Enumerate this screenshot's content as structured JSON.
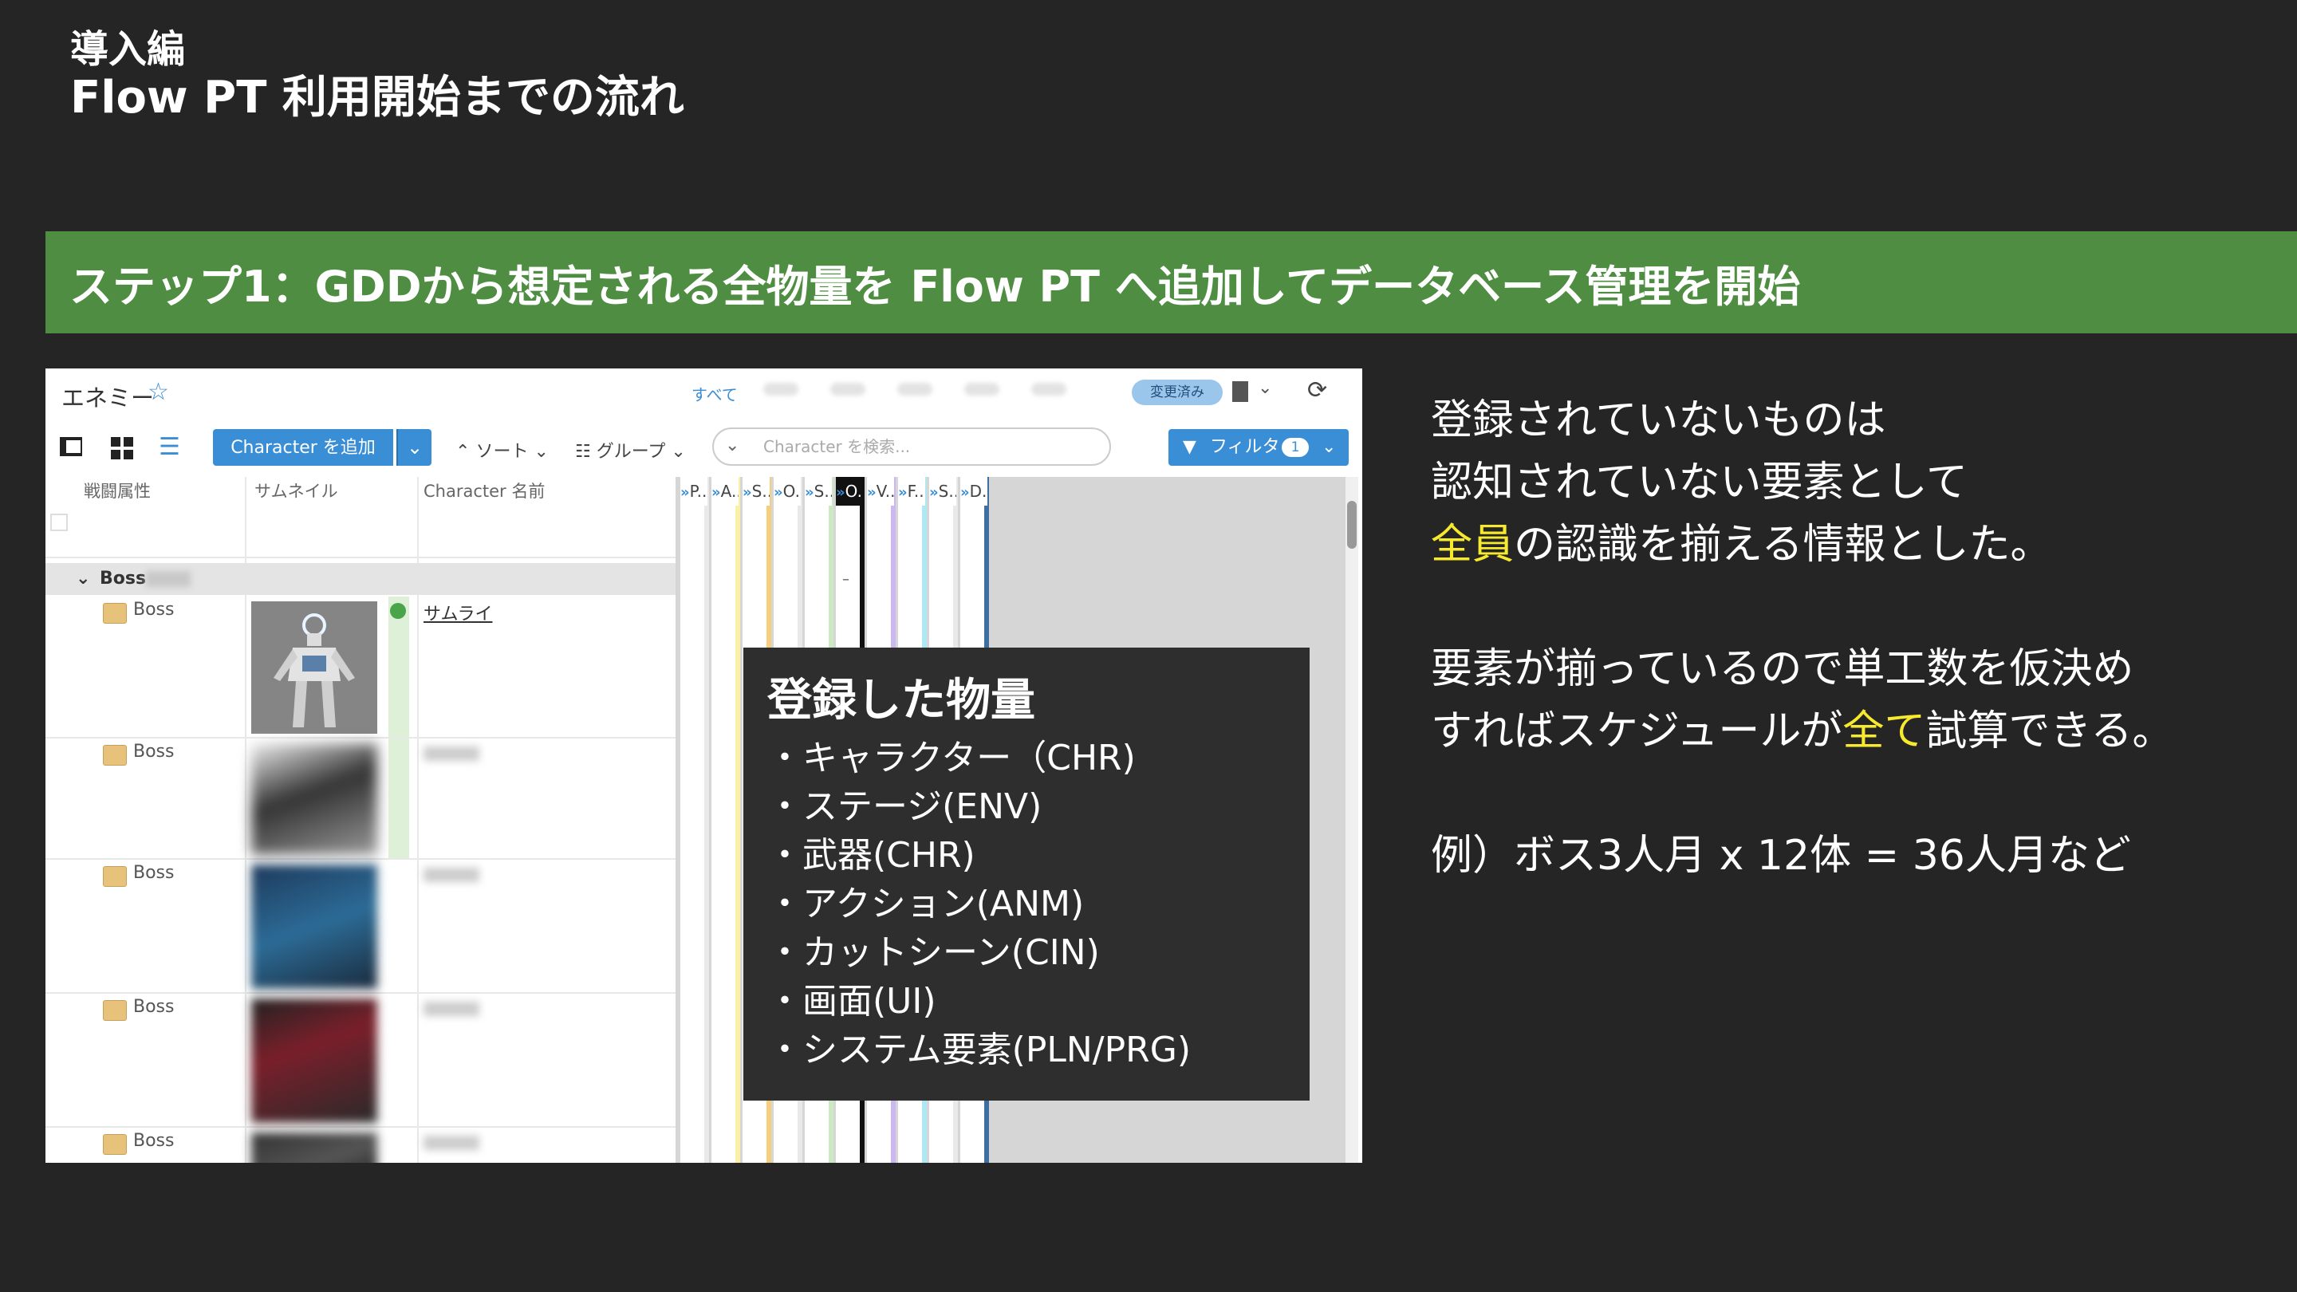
{
  "slide": {
    "sup_title": "導入編",
    "main_title": "Flow PT 利用開始までの流れ",
    "step_banner": "ステップ1：GDDから想定される全物量を Flow PT へ追加してデータベース管理を開始"
  },
  "app": {
    "header": {
      "title": "エネミー",
      "star_icon": "☆",
      "filter_all": "すべて",
      "changed_badge": "変更済み",
      "refresh_icon": "⟳"
    },
    "toolbar": {
      "add_button": "Character を追加",
      "sort_label": "ソート",
      "group_label": "グループ",
      "search_placeholder": "Character を検索...",
      "filter_label": "フィルタ",
      "filter_count": "1"
    },
    "columns": [
      "戦闘属性",
      "サムネイル",
      "Character 名前"
    ],
    "right_columns": [
      "P..",
      "A..",
      "S..",
      "O..",
      "S..",
      "O..",
      "V..",
      "F..",
      "S..",
      "D.."
    ],
    "right_column_colors": [
      "#e9e9e9",
      "#fbf0a8",
      "#f5cf7e",
      "#e9e9e9",
      "#cde9c2",
      "#111111",
      "#cdb7f2",
      "#aee8f2",
      "#e9e9e9",
      "#3f6fa0"
    ],
    "group": {
      "label": "Boss"
    },
    "rows": [
      {
        "type": "Boss",
        "name": "サムライ"
      },
      {
        "type": "Boss"
      },
      {
        "type": "Boss"
      },
      {
        "type": "Boss"
      },
      {
        "type": "Boss"
      }
    ],
    "cell_dash": "–"
  },
  "overlay": {
    "title": "登録した物量",
    "items": [
      "・キャラクター（CHR)",
      "・ステージ(ENV)",
      "・武器(CHR)",
      "・アクション(ANM)",
      "・カットシーン(CIN)",
      "・画面(UI)",
      "・システム要素(PLN/PRG)"
    ]
  },
  "notes": {
    "p1_line1": "登録されていないものは",
    "p1_line2": "認知されていない要素として",
    "p1_line3_highlight": "全員",
    "p1_line3_rest": "の認識を揃える情報とした。",
    "p2_line1": "要素が揃っているので単工数を仮決め",
    "p2_line2_pre": "すればスケジュールが",
    "p2_line2_highlight": "全て",
    "p2_line2_post": "試算できる。",
    "p3_line1": "例）ボス3人月 x 12体 = 36人月など",
    "highlight_color": "#f7ea2e"
  }
}
